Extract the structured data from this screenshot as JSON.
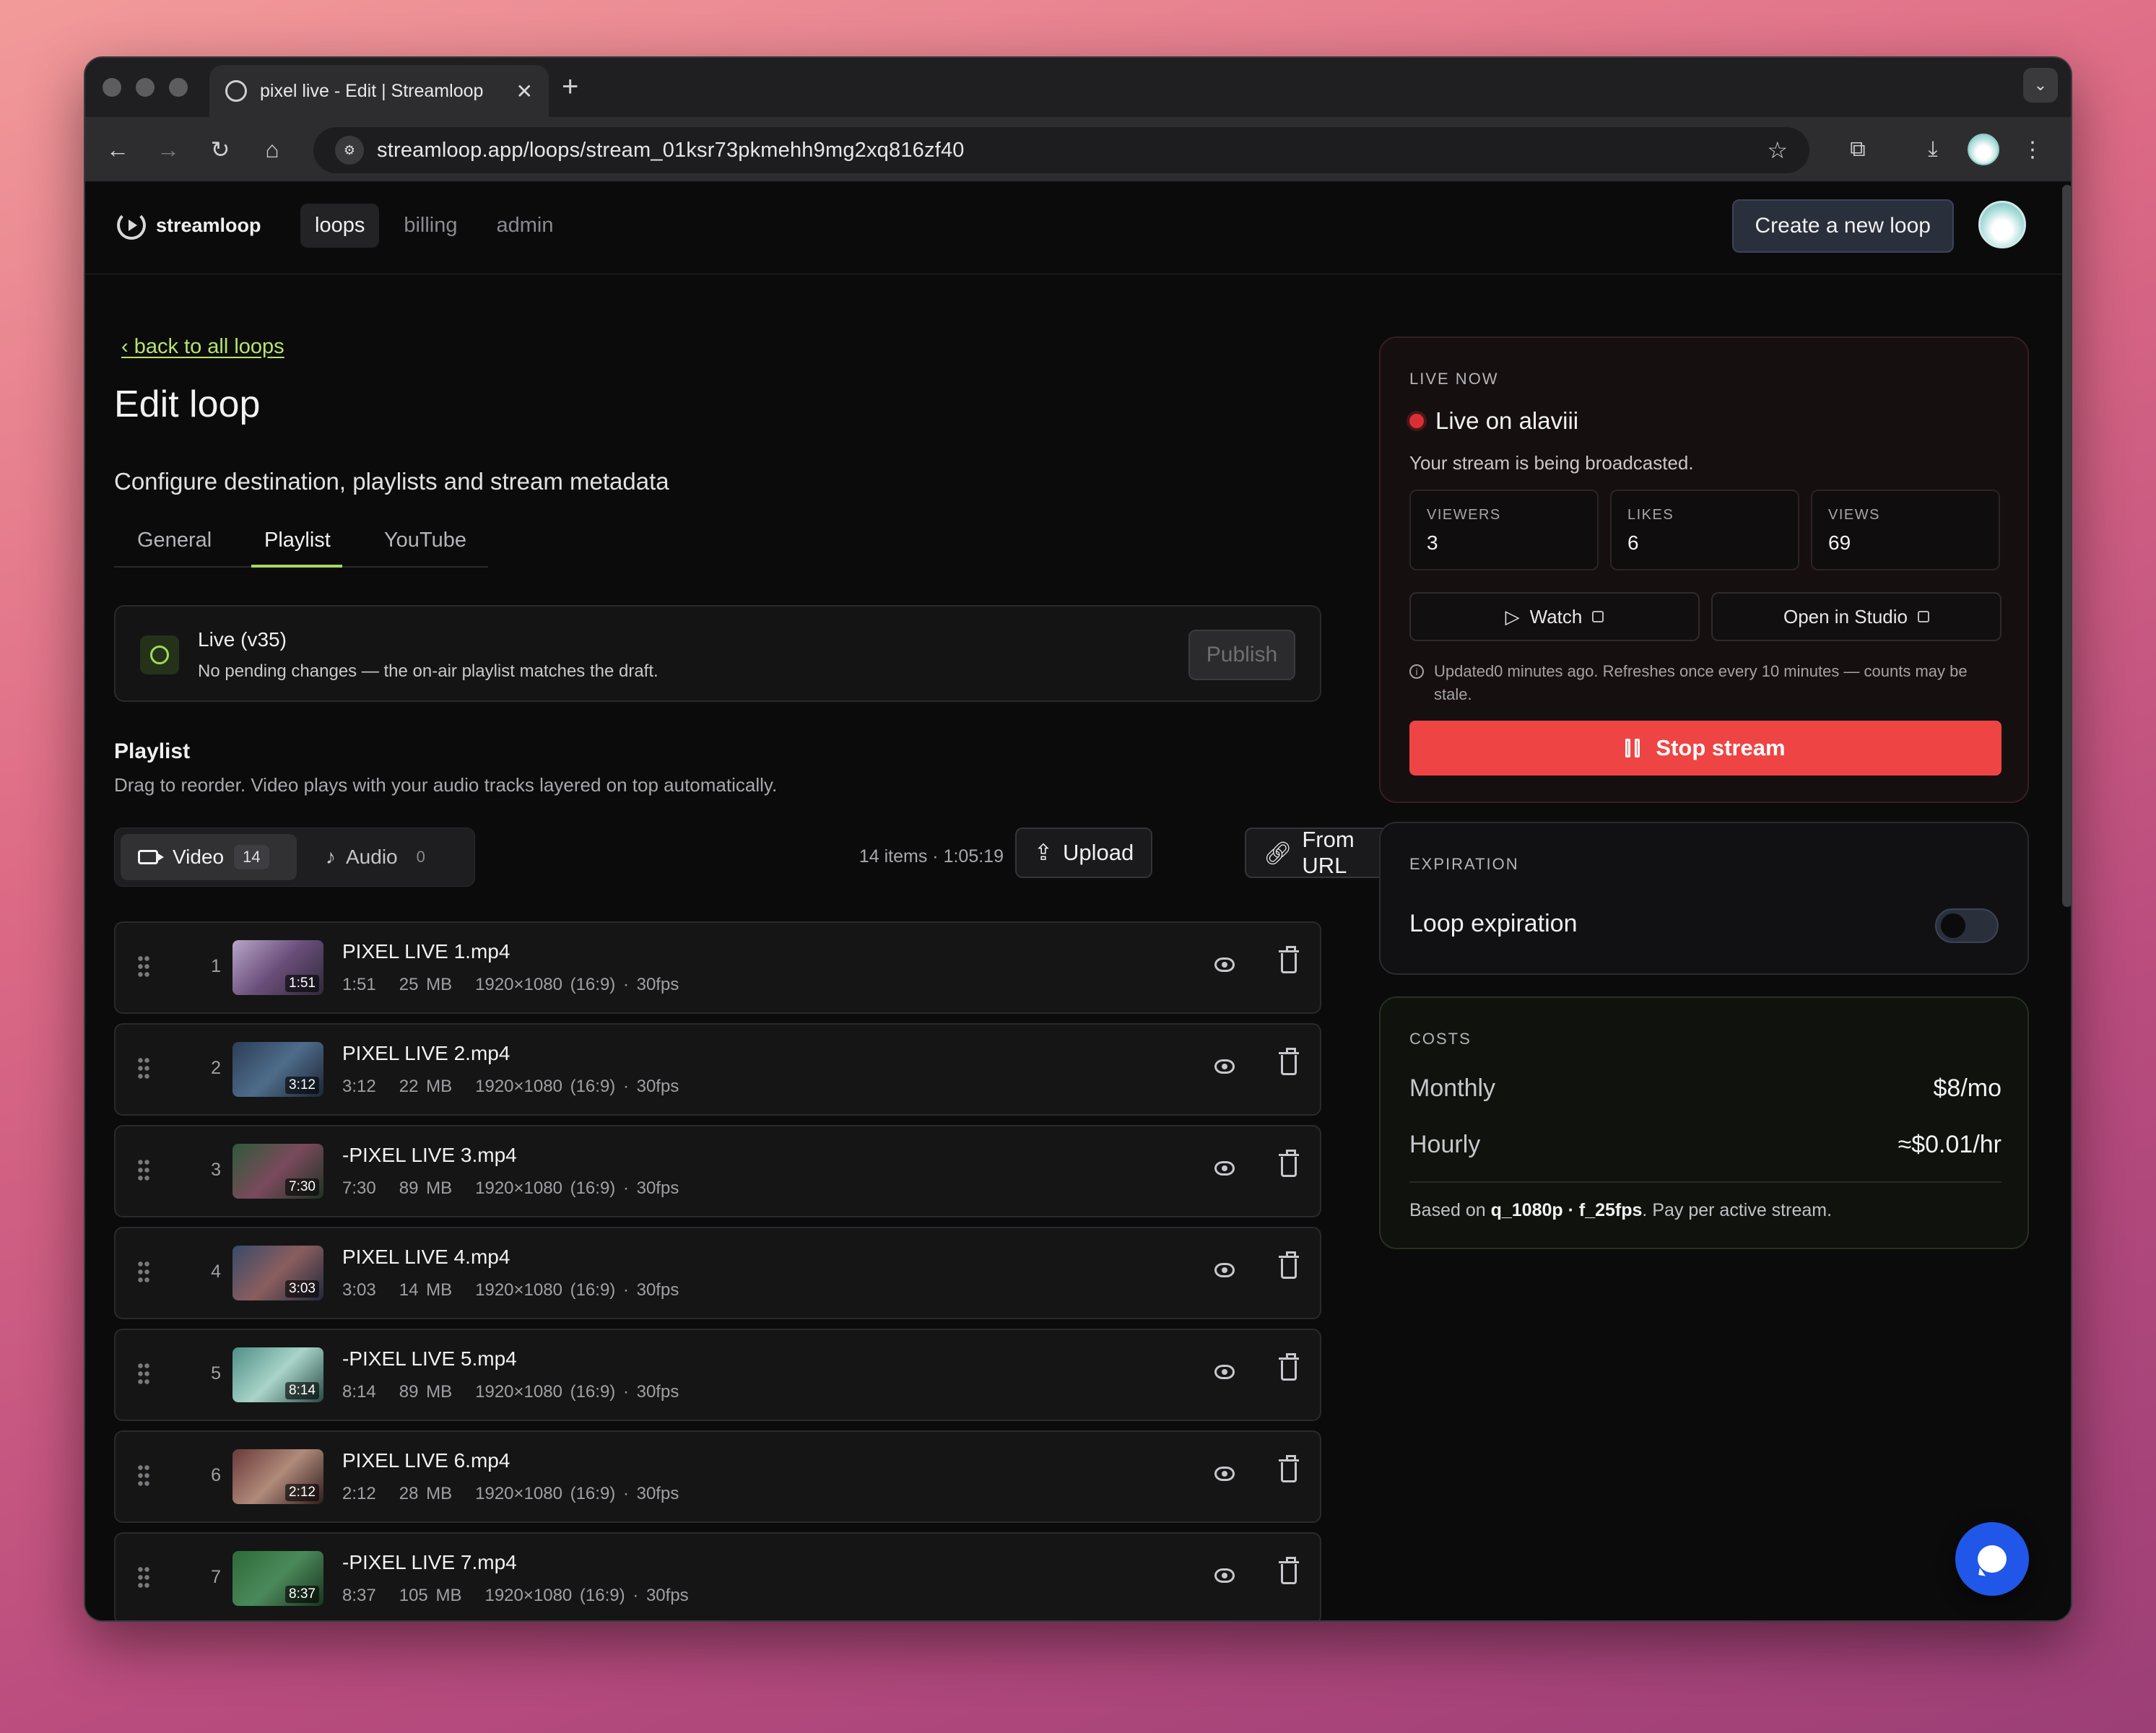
{
  "browser": {
    "tab_title": "pixel live - Edit | Streamloop",
    "new_tab": "+",
    "tab_close": "✕",
    "url": "streamloop.app/loops/stream_01ksr73pkmehh9mg2xq816zf40"
  },
  "appbar": {
    "brand": "streamloop",
    "nav": [
      "loops",
      "billing",
      "admin"
    ],
    "create_button": "Create a new loop"
  },
  "page": {
    "back_link": "back to all loops",
    "title": "Edit loop",
    "subtitle": "Configure destination, playlists and stream metadata",
    "tabs": [
      "General",
      "Playlist",
      "YouTube"
    ]
  },
  "status": {
    "title": "Live (v35)",
    "description": "No pending changes — the on-air playlist matches the draft.",
    "publish_label": "Publish"
  },
  "playlist": {
    "title": "Playlist",
    "description": "Drag to reorder. Video plays with your audio tracks layered on top automatically.",
    "video_label": "Video",
    "video_count": "14",
    "audio_label": "Audio",
    "audio_count": "0",
    "summary": "14 items · 1:05:19",
    "upload_label": "Upload",
    "from_url_label": "From URL",
    "items": [
      {
        "index": "1",
        "name": "PIXEL LIVE 1.mp4",
        "duration": "1:51",
        "size": "25 MB",
        "spec": "1920×1080 (16:9) · 30fps",
        "thumb": [
          "#b7a6c8",
          "#6a4e7a",
          "#2e2a3a"
        ]
      },
      {
        "index": "2",
        "name": "PIXEL LIVE 2.mp4",
        "duration": "3:12",
        "size": "22 MB",
        "spec": "1920×1080 (16:9) · 30fps",
        "thumb": [
          "#2c3e57",
          "#4e6c8a",
          "#1d2533"
        ]
      },
      {
        "index": "3",
        "name": "-PIXEL LIVE 3.mp4",
        "duration": "7:30",
        "size": "89 MB",
        "spec": "1920×1080 (16:9) · 30fps",
        "thumb": [
          "#2f5a3a",
          "#7a4a5c",
          "#1e3324"
        ]
      },
      {
        "index": "4",
        "name": "PIXEL LIVE 4.mp4",
        "duration": "3:03",
        "size": "14 MB",
        "spec": "1920×1080 (16:9) · 30fps",
        "thumb": [
          "#3a4a6a",
          "#8a5e5e",
          "#22283a"
        ]
      },
      {
        "index": "5",
        "name": "-PIXEL LIVE 5.mp4",
        "duration": "8:14",
        "size": "89 MB",
        "spec": "1920×1080 (16:9) · 30fps",
        "thumb": [
          "#4e8f86",
          "#a9d4c9",
          "#274a44"
        ]
      },
      {
        "index": "6",
        "name": "PIXEL LIVE 6.mp4",
        "duration": "2:12",
        "size": "28 MB",
        "spec": "1920×1080 (16:9) · 30fps",
        "thumb": [
          "#6a3a3a",
          "#b08a7a",
          "#2e1c1c"
        ]
      },
      {
        "index": "7",
        "name": "-PIXEL LIVE 7.mp4",
        "duration": "8:37",
        "size": "105 MB",
        "spec": "1920×1080 (16:9) · 30fps",
        "thumb": [
          "#2f6a3a",
          "#4a8a5a",
          "#1a3320"
        ]
      }
    ]
  },
  "live": {
    "eyebrow": "LIVE NOW",
    "title": "Live on alaviii",
    "description": "Your stream is being broadcasted.",
    "stats": [
      {
        "label": "VIEWERS",
        "value": "3"
      },
      {
        "label": "LIKES",
        "value": "6"
      },
      {
        "label": "VIEWS",
        "value": "69"
      }
    ],
    "watch_label": "Watch",
    "studio_label": "Open in Studio",
    "updated_note": "Updated0 minutes ago. Refreshes once every 10 minutes — counts may be stale.",
    "stop_label": "Stop stream"
  },
  "expiration": {
    "eyebrow": "EXPIRATION",
    "label": "Loop expiration",
    "enabled": false
  },
  "costs": {
    "eyebrow": "COSTS",
    "monthly_label": "Monthly",
    "monthly_value": "$8/mo",
    "hourly_label": "Hourly",
    "hourly_value": "≈$0.01/hr",
    "foot_prefix": "Based on",
    "foot_quality": "q_1080p · f_25fps",
    "foot_suffix": ". Pay per active stream."
  },
  "colors": {
    "accent": "#a6d957",
    "danger": "#ef4444",
    "chat": "#2057e8"
  }
}
